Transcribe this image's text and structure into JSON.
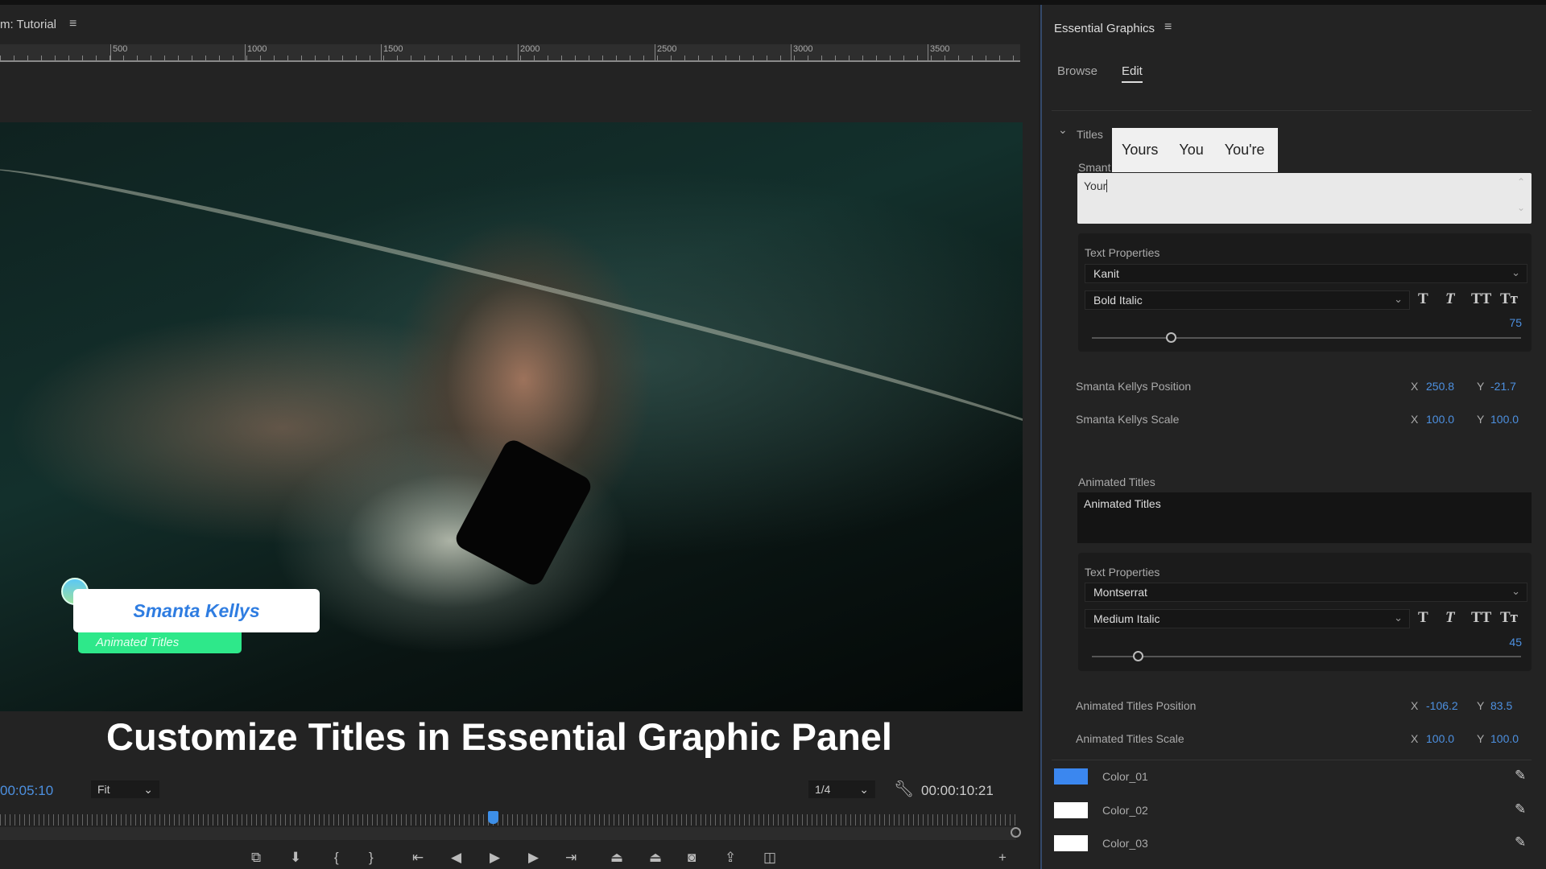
{
  "monitor": {
    "title": "m: Tutorial",
    "ruler_labels": [
      "500",
      "1000",
      "1500",
      "2000",
      "2500",
      "3000",
      "3500"
    ],
    "video": {
      "name_card": "Smanta Kellys",
      "subtitle_card": "Animated Titles",
      "caption": "Customize Titles in Essential Graphic Panel"
    },
    "current_timecode": "00:05:10",
    "zoom": "Fit",
    "resolution": "1/4",
    "duration_timecode": "00:00:10:21",
    "playhead_fraction": 0.485,
    "accent": "#3d8fe8"
  },
  "panel": {
    "title": "Essential Graphics",
    "tabs": [
      {
        "label": "Browse",
        "active": false
      },
      {
        "label": "Edit",
        "active": true
      }
    ],
    "section": "Titles",
    "autocomplete": [
      "Yours",
      "You",
      "You're"
    ],
    "layer1": {
      "label": "Smant",
      "text": "Your",
      "text_properties_label": "Text Properties",
      "font": "Kanit",
      "style": "Bold Italic",
      "size": "75",
      "position_label": "Smanta Kellys Position",
      "pos_x": "250.8",
      "pos_y": "-21.7",
      "scale_label": "Smanta Kellys Scale",
      "scale_x": "100.0",
      "scale_y": "100.0"
    },
    "layer2": {
      "label": "Animated Titles",
      "text": "Animated Titles",
      "text_properties_label": "Text Properties",
      "font": "Montserrat",
      "style": "Medium Italic",
      "size": "45",
      "position_label": "Animated Titles Position",
      "pos_x": "-106.2",
      "pos_y": "83.5",
      "scale_label": "Animated Titles Scale",
      "scale_x": "100.0",
      "scale_y": "100.0"
    },
    "axis_x": "X",
    "axis_y": "Y",
    "style_buttons": [
      "T",
      "T",
      "TT",
      "Tт"
    ],
    "colors": [
      {
        "label": "Color_01",
        "value": "#3b87ef"
      },
      {
        "label": "Color_02",
        "value": "#ffffff"
      },
      {
        "label": "Color_03",
        "value": "#ffffff"
      }
    ]
  }
}
